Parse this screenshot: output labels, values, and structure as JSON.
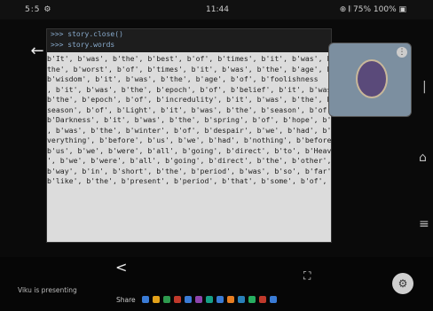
{
  "status": {
    "left": "5:5 ⚙",
    "time": "11:44",
    "right": "⊕ 𝄃 75% 100% ▣"
  },
  "icons": {
    "back": "back-arrow-icon",
    "share": "share-icon",
    "fullscreen": "fullscreen-icon",
    "fab": "settings-fab-icon"
  },
  "code": {
    "prompt_lines": [
      ">>> story.close()",
      ">>> story.words"
    ],
    "output_lines": [
      "b'It', b'was', b'the', b'best', b'of', b'times', b'it', b'was', b'",
      "the', b'worst', b'of', b'times', b'it', b'was', b'the', b'age', b'o",
      "b'wisdom', b'it', b'was', b'the', b'age', b'of', b'foolishness",
      ", b'it', b'was', b'the', b'epoch', b'of', b'belief', b'it', b'was'",
      "b'the', b'epoch', b'of', b'incredulity', b'it', b'was', b'the', b",
      "season', b'of', b'Light', b'it', b'was', b'the', b'season', b'of',",
      "b'Darkness', b'it', b'was', b'the', b'spring', b'of', b'hope', b'it",
      ", b'was', b'the', b'winter', b'of', b'despair', b'we', b'had', b'e",
      "verything', b'before', b'us', b'we', b'had', b'nothing', b'before',",
      "b'us', b'we', b'were', b'all', b'going', b'direct', b'to', b'Heave",
      "', b'we', b'were', b'all', b'going', b'direct', b'the', b'other',",
      "b'way', b'in', b'short', b'the', b'period', b'was', b'so', b'far',",
      "b'like', b'the', b'present', b'period', b'that', b'some', b'of', b"
    ]
  },
  "bottom": {
    "caption": "Viku is presenting",
    "share_label": "Share"
  },
  "colors": {
    "accent": "#8ac",
    "background": "#0a0a0a"
  }
}
